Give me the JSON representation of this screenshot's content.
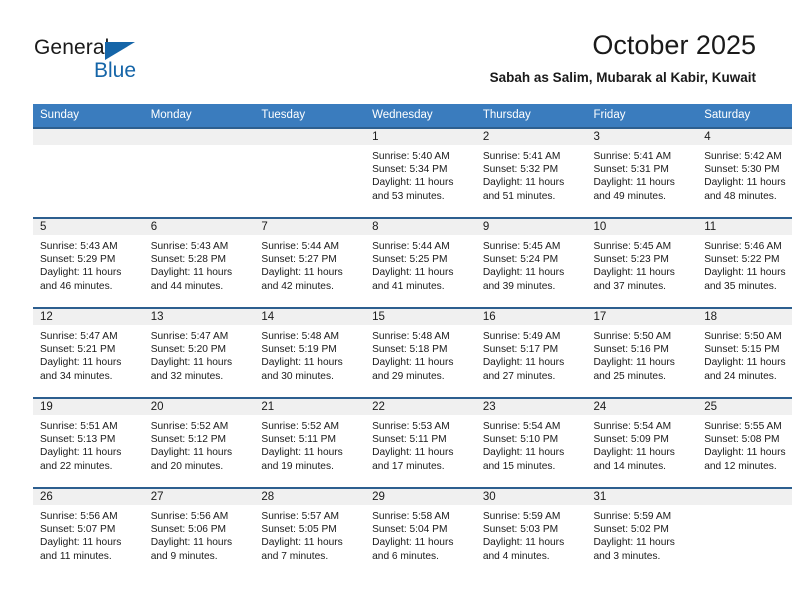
{
  "brand": {
    "name_part1": "General",
    "name_part2": "Blue",
    "accent_color": "#1565a8"
  },
  "header": {
    "title": "October 2025",
    "subtitle": "Sabah as Salim, Mubarak al Kabir, Kuwait"
  },
  "theme": {
    "header_row_color": "#3a7cbe",
    "row_border_color": "#2d5f8f",
    "daynum_band_color": "#f0f0f0"
  },
  "weekday_headers": [
    "Sunday",
    "Monday",
    "Tuesday",
    "Wednesday",
    "Thursday",
    "Friday",
    "Saturday"
  ],
  "weeks": [
    [
      {
        "day": "",
        "sunrise": "",
        "sunset": "",
        "daylight_line1": "",
        "daylight_line2": ""
      },
      {
        "day": "",
        "sunrise": "",
        "sunset": "",
        "daylight_line1": "",
        "daylight_line2": ""
      },
      {
        "day": "",
        "sunrise": "",
        "sunset": "",
        "daylight_line1": "",
        "daylight_line2": ""
      },
      {
        "day": "1",
        "sunrise": "Sunrise: 5:40 AM",
        "sunset": "Sunset: 5:34 PM",
        "daylight_line1": "Daylight: 11 hours",
        "daylight_line2": "and 53 minutes."
      },
      {
        "day": "2",
        "sunrise": "Sunrise: 5:41 AM",
        "sunset": "Sunset: 5:32 PM",
        "daylight_line1": "Daylight: 11 hours",
        "daylight_line2": "and 51 minutes."
      },
      {
        "day": "3",
        "sunrise": "Sunrise: 5:41 AM",
        "sunset": "Sunset: 5:31 PM",
        "daylight_line1": "Daylight: 11 hours",
        "daylight_line2": "and 49 minutes."
      },
      {
        "day": "4",
        "sunrise": "Sunrise: 5:42 AM",
        "sunset": "Sunset: 5:30 PM",
        "daylight_line1": "Daylight: 11 hours",
        "daylight_line2": "and 48 minutes."
      }
    ],
    [
      {
        "day": "5",
        "sunrise": "Sunrise: 5:43 AM",
        "sunset": "Sunset: 5:29 PM",
        "daylight_line1": "Daylight: 11 hours",
        "daylight_line2": "and 46 minutes."
      },
      {
        "day": "6",
        "sunrise": "Sunrise: 5:43 AM",
        "sunset": "Sunset: 5:28 PM",
        "daylight_line1": "Daylight: 11 hours",
        "daylight_line2": "and 44 minutes."
      },
      {
        "day": "7",
        "sunrise": "Sunrise: 5:44 AM",
        "sunset": "Sunset: 5:27 PM",
        "daylight_line1": "Daylight: 11 hours",
        "daylight_line2": "and 42 minutes."
      },
      {
        "day": "8",
        "sunrise": "Sunrise: 5:44 AM",
        "sunset": "Sunset: 5:25 PM",
        "daylight_line1": "Daylight: 11 hours",
        "daylight_line2": "and 41 minutes."
      },
      {
        "day": "9",
        "sunrise": "Sunrise: 5:45 AM",
        "sunset": "Sunset: 5:24 PM",
        "daylight_line1": "Daylight: 11 hours",
        "daylight_line2": "and 39 minutes."
      },
      {
        "day": "10",
        "sunrise": "Sunrise: 5:45 AM",
        "sunset": "Sunset: 5:23 PM",
        "daylight_line1": "Daylight: 11 hours",
        "daylight_line2": "and 37 minutes."
      },
      {
        "day": "11",
        "sunrise": "Sunrise: 5:46 AM",
        "sunset": "Sunset: 5:22 PM",
        "daylight_line1": "Daylight: 11 hours",
        "daylight_line2": "and 35 minutes."
      }
    ],
    [
      {
        "day": "12",
        "sunrise": "Sunrise: 5:47 AM",
        "sunset": "Sunset: 5:21 PM",
        "daylight_line1": "Daylight: 11 hours",
        "daylight_line2": "and 34 minutes."
      },
      {
        "day": "13",
        "sunrise": "Sunrise: 5:47 AM",
        "sunset": "Sunset: 5:20 PM",
        "daylight_line1": "Daylight: 11 hours",
        "daylight_line2": "and 32 minutes."
      },
      {
        "day": "14",
        "sunrise": "Sunrise: 5:48 AM",
        "sunset": "Sunset: 5:19 PM",
        "daylight_line1": "Daylight: 11 hours",
        "daylight_line2": "and 30 minutes."
      },
      {
        "day": "15",
        "sunrise": "Sunrise: 5:48 AM",
        "sunset": "Sunset: 5:18 PM",
        "daylight_line1": "Daylight: 11 hours",
        "daylight_line2": "and 29 minutes."
      },
      {
        "day": "16",
        "sunrise": "Sunrise: 5:49 AM",
        "sunset": "Sunset: 5:17 PM",
        "daylight_line1": "Daylight: 11 hours",
        "daylight_line2": "and 27 minutes."
      },
      {
        "day": "17",
        "sunrise": "Sunrise: 5:50 AM",
        "sunset": "Sunset: 5:16 PM",
        "daylight_line1": "Daylight: 11 hours",
        "daylight_line2": "and 25 minutes."
      },
      {
        "day": "18",
        "sunrise": "Sunrise: 5:50 AM",
        "sunset": "Sunset: 5:15 PM",
        "daylight_line1": "Daylight: 11 hours",
        "daylight_line2": "and 24 minutes."
      }
    ],
    [
      {
        "day": "19",
        "sunrise": "Sunrise: 5:51 AM",
        "sunset": "Sunset: 5:13 PM",
        "daylight_line1": "Daylight: 11 hours",
        "daylight_line2": "and 22 minutes."
      },
      {
        "day": "20",
        "sunrise": "Sunrise: 5:52 AM",
        "sunset": "Sunset: 5:12 PM",
        "daylight_line1": "Daylight: 11 hours",
        "daylight_line2": "and 20 minutes."
      },
      {
        "day": "21",
        "sunrise": "Sunrise: 5:52 AM",
        "sunset": "Sunset: 5:11 PM",
        "daylight_line1": "Daylight: 11 hours",
        "daylight_line2": "and 19 minutes."
      },
      {
        "day": "22",
        "sunrise": "Sunrise: 5:53 AM",
        "sunset": "Sunset: 5:11 PM",
        "daylight_line1": "Daylight: 11 hours",
        "daylight_line2": "and 17 minutes."
      },
      {
        "day": "23",
        "sunrise": "Sunrise: 5:54 AM",
        "sunset": "Sunset: 5:10 PM",
        "daylight_line1": "Daylight: 11 hours",
        "daylight_line2": "and 15 minutes."
      },
      {
        "day": "24",
        "sunrise": "Sunrise: 5:54 AM",
        "sunset": "Sunset: 5:09 PM",
        "daylight_line1": "Daylight: 11 hours",
        "daylight_line2": "and 14 minutes."
      },
      {
        "day": "25",
        "sunrise": "Sunrise: 5:55 AM",
        "sunset": "Sunset: 5:08 PM",
        "daylight_line1": "Daylight: 11 hours",
        "daylight_line2": "and 12 minutes."
      }
    ],
    [
      {
        "day": "26",
        "sunrise": "Sunrise: 5:56 AM",
        "sunset": "Sunset: 5:07 PM",
        "daylight_line1": "Daylight: 11 hours",
        "daylight_line2": "and 11 minutes."
      },
      {
        "day": "27",
        "sunrise": "Sunrise: 5:56 AM",
        "sunset": "Sunset: 5:06 PM",
        "daylight_line1": "Daylight: 11 hours",
        "daylight_line2": "and 9 minutes."
      },
      {
        "day": "28",
        "sunrise": "Sunrise: 5:57 AM",
        "sunset": "Sunset: 5:05 PM",
        "daylight_line1": "Daylight: 11 hours",
        "daylight_line2": "and 7 minutes."
      },
      {
        "day": "29",
        "sunrise": "Sunrise: 5:58 AM",
        "sunset": "Sunset: 5:04 PM",
        "daylight_line1": "Daylight: 11 hours",
        "daylight_line2": "and 6 minutes."
      },
      {
        "day": "30",
        "sunrise": "Sunrise: 5:59 AM",
        "sunset": "Sunset: 5:03 PM",
        "daylight_line1": "Daylight: 11 hours",
        "daylight_line2": "and 4 minutes."
      },
      {
        "day": "31",
        "sunrise": "Sunrise: 5:59 AM",
        "sunset": "Sunset: 5:02 PM",
        "daylight_line1": "Daylight: 11 hours",
        "daylight_line2": "and 3 minutes."
      },
      {
        "day": "",
        "sunrise": "",
        "sunset": "",
        "daylight_line1": "",
        "daylight_line2": ""
      }
    ]
  ]
}
